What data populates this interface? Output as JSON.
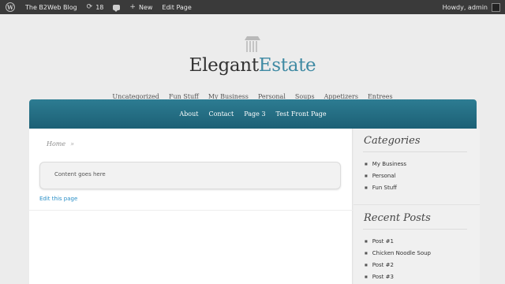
{
  "admin_bar": {
    "site_name": "The B2Web Blog",
    "updates_count": "18",
    "new_label": "New",
    "edit_page_label": "Edit Page",
    "howdy": "Howdy, admin"
  },
  "site": {
    "logo_first": "Elegant",
    "logo_second": "Estate",
    "accent_color": "#3f8aa3"
  },
  "category_nav": [
    "Uncategorized",
    "Fun Stuff",
    "My Business",
    "Personal",
    "Soups",
    "Appetizers",
    "Entrees"
  ],
  "page_nav": [
    "About",
    "Contact",
    "Page 3",
    "Test Front Page"
  ],
  "page_nav_color": "#1f6a80",
  "content": {
    "breadcrumb_home": "Home",
    "breadcrumb_sep": "»",
    "body_text": "Content goes here",
    "edit_link": "Edit this page"
  },
  "sidebar": {
    "categories_title": "Categories",
    "categories": [
      "My Business",
      "Personal",
      "Fun Stuff"
    ],
    "recent_posts_title": "Recent Posts",
    "recent_posts": [
      "Post #1",
      "Chicken Noodle Soup",
      "Post #2",
      "Post #3"
    ]
  }
}
